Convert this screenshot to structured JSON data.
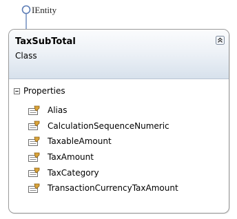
{
  "interface": {
    "name": "IEntity",
    "icon": "interface-lollipop-icon"
  },
  "class": {
    "name": "TaxSubTotal",
    "kind": "Class",
    "collapse_icon": "double-chevron-up-icon"
  },
  "compartment": {
    "label": "Properties",
    "expander_icon": "collapse-minus-icon",
    "member_icon": "property-icon",
    "members": [
      "Alias",
      "CalculationSequenceNumeric",
      "TaxableAmount",
      "TaxAmount",
      "TaxCategory",
      "TransactionCurrencyTaxAmount"
    ]
  },
  "colors": {
    "lollipop": "#5b7cb5",
    "border": "#9a9a9a",
    "header_gradient_bottom": "#d7e1ec"
  }
}
